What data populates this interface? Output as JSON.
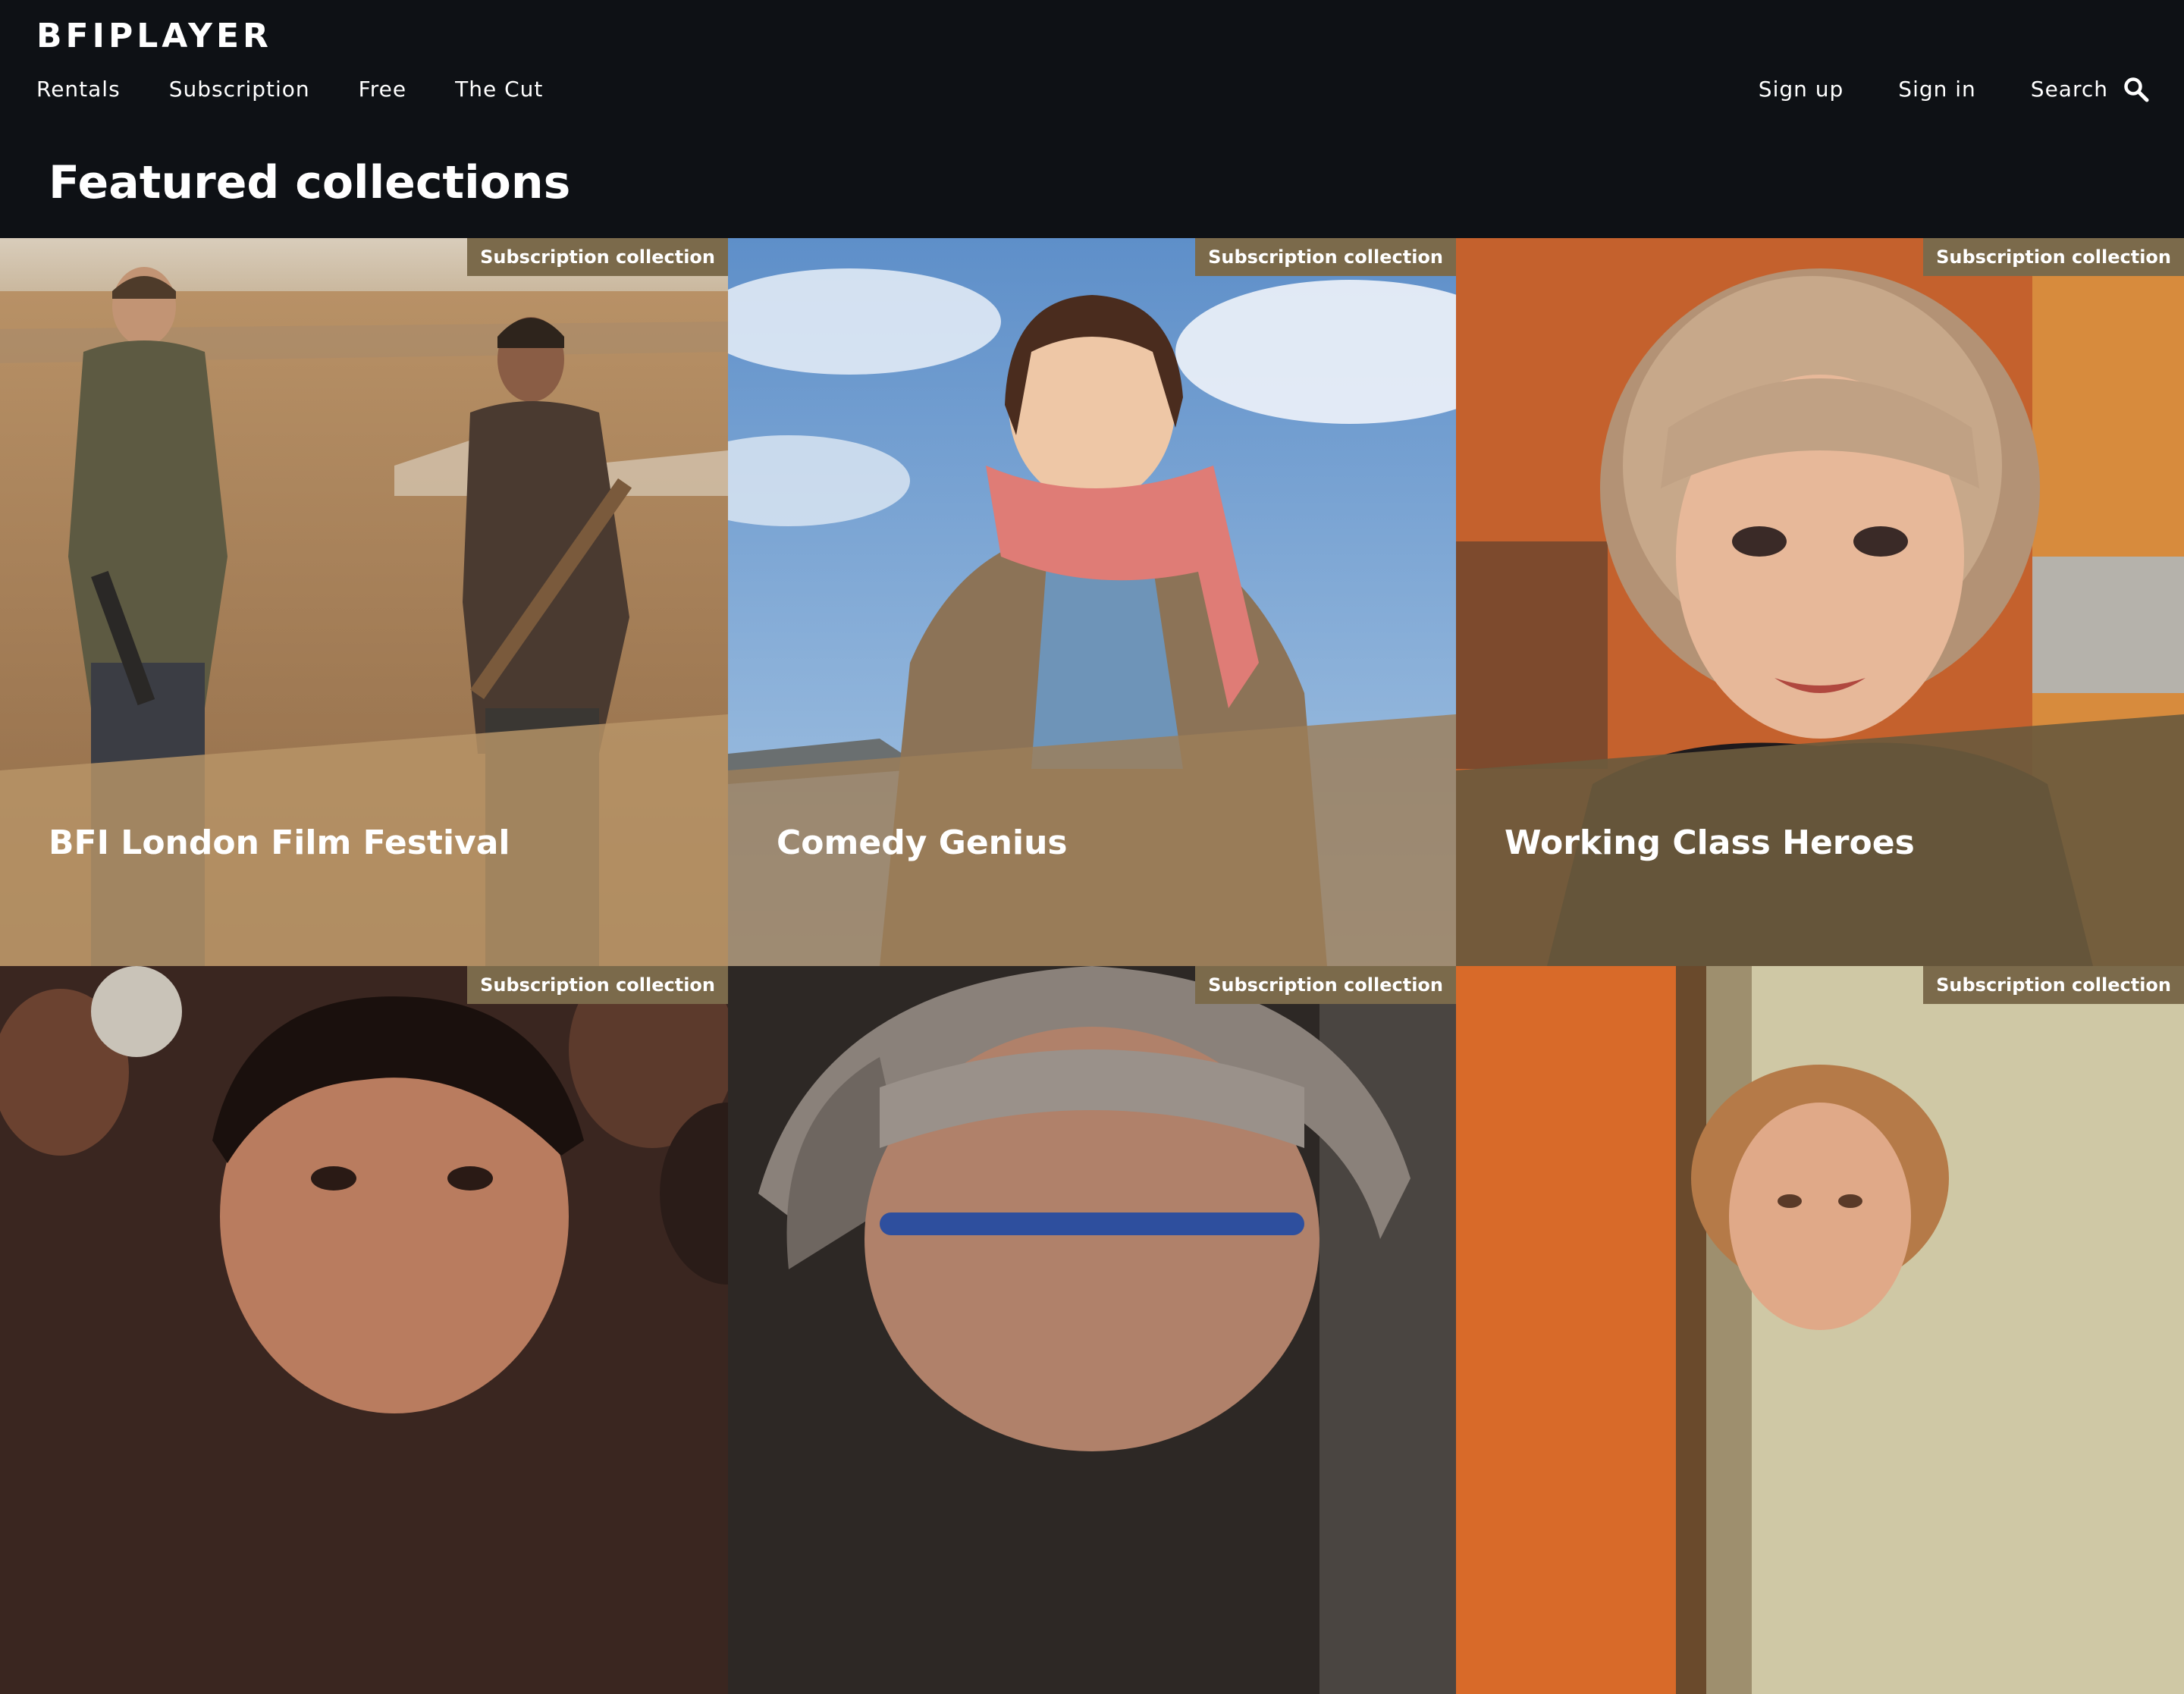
{
  "header": {
    "logo": "BFIPLAYER",
    "nav_left": [
      "Rentals",
      "Subscription",
      "Free",
      "The Cut"
    ],
    "sign_up": "Sign up",
    "sign_in": "Sign in",
    "search_label": "Search",
    "search_icon": "search-icon"
  },
  "page": {
    "title": "Featured collections"
  },
  "collections": [
    {
      "badge": "Subscription collection",
      "title": "BFI London Film Festival"
    },
    {
      "badge": "Subscription collection",
      "title": "Comedy Genius"
    },
    {
      "badge": "Subscription collection",
      "title": "Working Class Heroes"
    },
    {
      "badge": "Subscription collection",
      "title": ""
    },
    {
      "badge": "Subscription collection",
      "title": ""
    },
    {
      "badge": "Subscription collection",
      "title": ""
    }
  ],
  "colors": {
    "background": "#0e1115",
    "badge": "#7b6a4b",
    "card_overlay_1": "#b89568",
    "card_overlay_2": "#9c7e59",
    "card_overlay_3": "#6b5a3d"
  }
}
